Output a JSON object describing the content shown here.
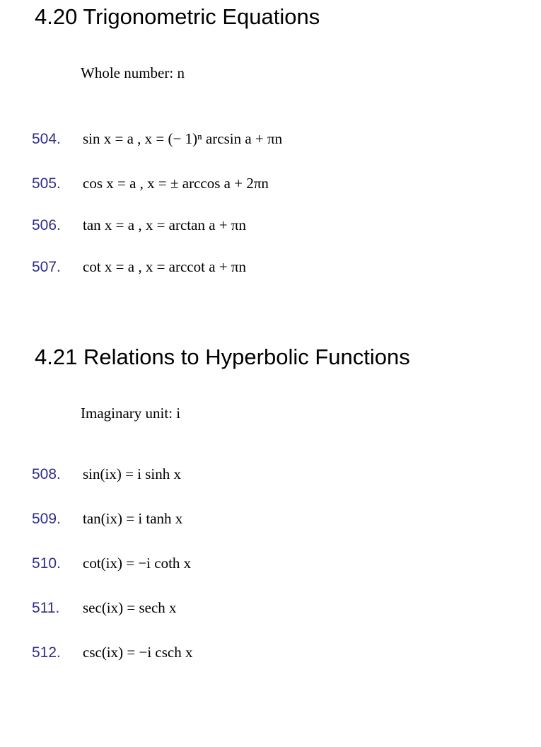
{
  "sections": [
    {
      "title": "4.20 Trigonometric Equations",
      "note": "Whole number: n",
      "formulas": [
        {
          "number": "504.",
          "text": "sin x = a ,  x = (− 1)ⁿ arcsin a + πn"
        },
        {
          "number": "505.",
          "text": "cos x = a ,  x = ± arccos a + 2πn"
        },
        {
          "number": "506.",
          "text": "tan x = a ,  x = arctan a + πn"
        },
        {
          "number": "507.",
          "text": "cot x = a ,  x = arccot a + πn"
        }
      ]
    },
    {
      "title": "4.21 Relations to Hyperbolic Functions",
      "note": "Imaginary unit: i",
      "formulas": [
        {
          "number": "508.",
          "text": "sin(ix) = i sinh x"
        },
        {
          "number": "509.",
          "text": "tan(ix) = i tanh x"
        },
        {
          "number": "510.",
          "text": "cot(ix) = −i coth x"
        },
        {
          "number": "511.",
          "text": "sec(ix) = sech x"
        },
        {
          "number": "512.",
          "text": "csc(ix) = −i csch x"
        }
      ]
    }
  ]
}
